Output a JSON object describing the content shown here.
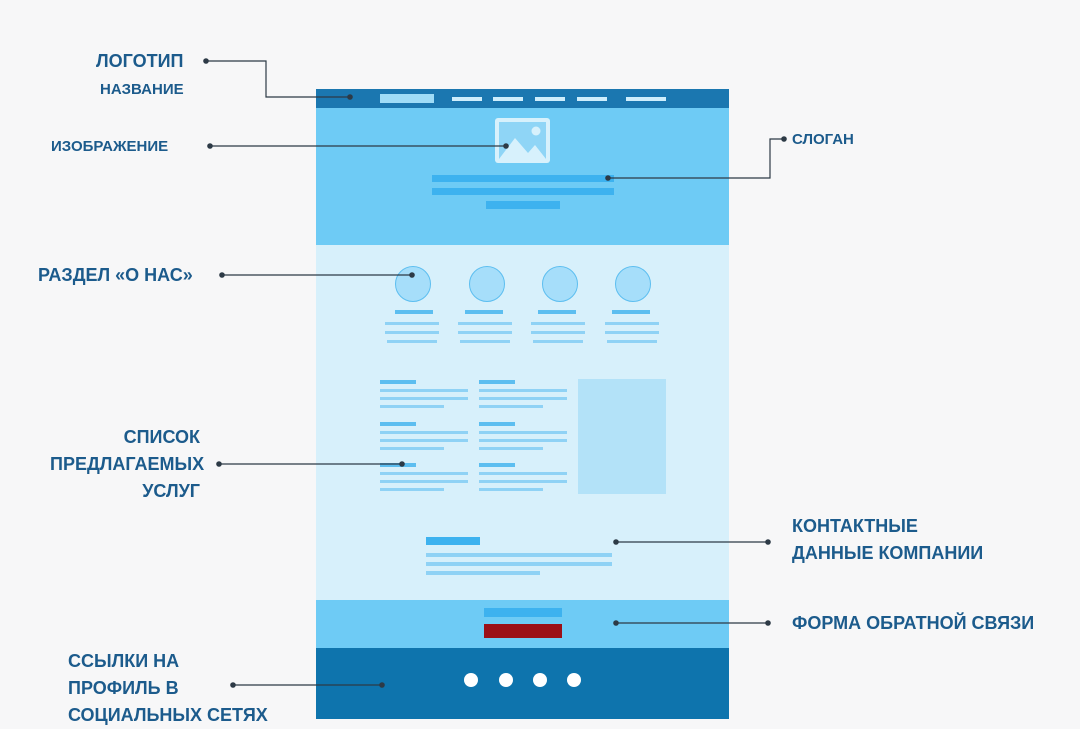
{
  "labels": {
    "logo": "ЛОГОТИП",
    "name": "НАЗВАНИЕ",
    "image": "ИЗОБРАЖЕНИЕ",
    "slogan": "СЛОГАН",
    "about": "РАЗДЕЛ «О НАС»",
    "services": [
      "СПИСОК",
      "ПРЕДЛАГАЕМЫХ",
      "УСЛУГ"
    ],
    "contacts": [
      "КОНТАКТНЫЕ",
      "ДАННЫЕ КОМПАНИИ"
    ],
    "feedback": "ФОРМА ОБРАТНОЙ СВЯЗИ",
    "social": [
      "ССЫЛКИ НА",
      "ПРОФИЛЬ В",
      "СОЦИАЛЬНЫХ СЕТЯХ"
    ]
  },
  "colors": {
    "label": "#1c5b8c",
    "header_bar": "#1b77b0",
    "hero": "#6ecbf5",
    "body": "#d7f0fb",
    "feedback_band": "#6ecbf5",
    "footer": "#0e74ad",
    "submit_button": "#9b0f17"
  }
}
